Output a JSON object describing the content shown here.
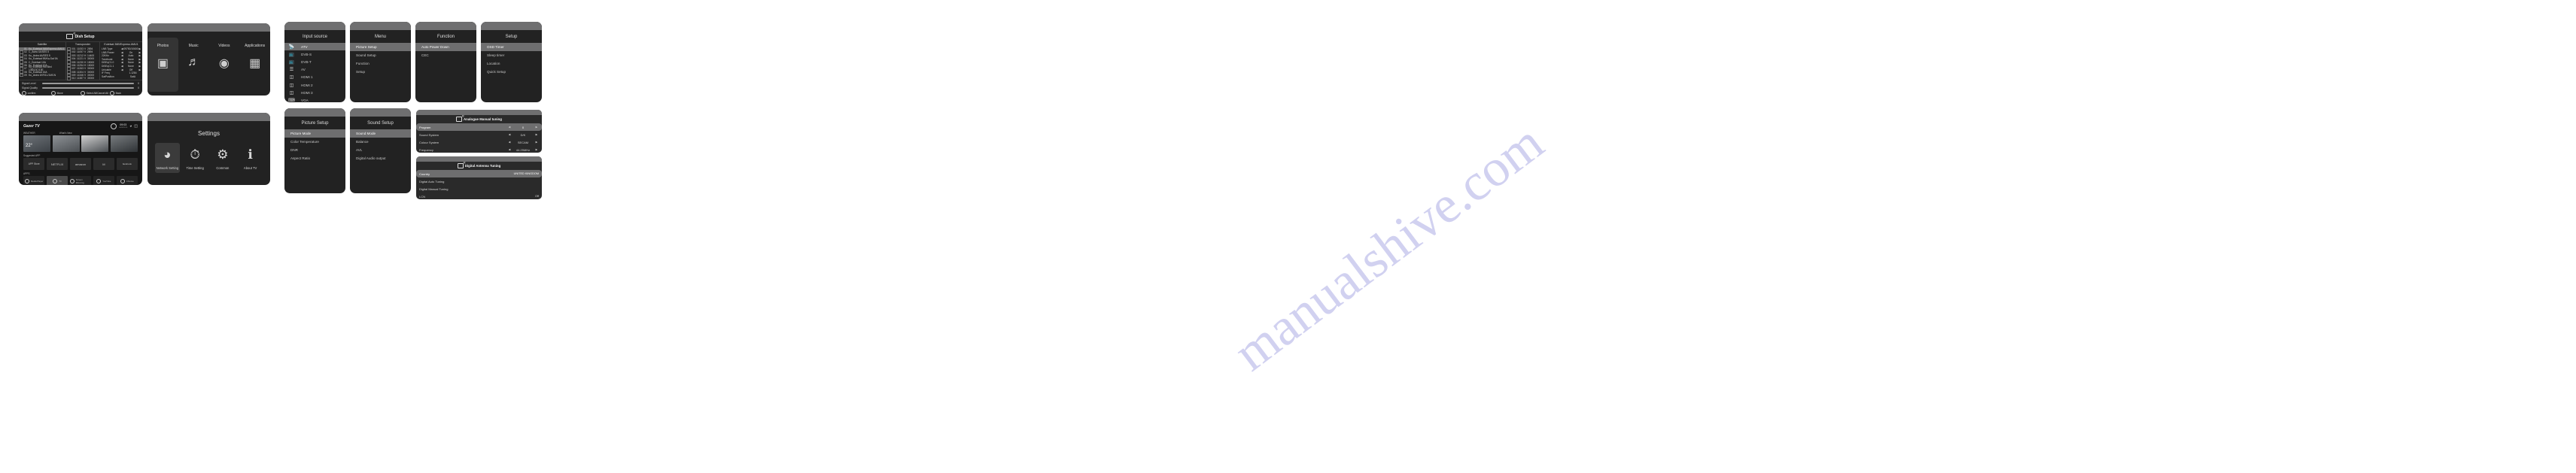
{
  "watermark": "manualshive.com",
  "dish_setup": {
    "title": "Dish Setup",
    "columns": {
      "satellite": "Satellite",
      "transponder": "Transponder",
      "lnb": "Eutelsat 36B/Express AMU1"
    },
    "satellites": [
      {
        "no": "01",
        "name": "Ku_Eutelsat 36B/Express AMU1"
      },
      {
        "no": "02",
        "name": "C_Astra 4A/SES 5"
      },
      {
        "no": "03",
        "name": "Ku_Astra 4A/SES 5"
      },
      {
        "no": "04",
        "name": "Ku_Eutelsat 9B/Ka-Sat 9A"
      },
      {
        "no": "05",
        "name": "C_Eutelsat 10A"
      },
      {
        "no": "06",
        "name": "Ku_Eutelsat 10A"
      },
      {
        "no": "07",
        "name": "Ku_Eutelsat Hot Bird 13B/13C/13E"
      },
      {
        "no": "08",
        "name": "Ku_Eutelsat 16A"
      },
      {
        "no": "09",
        "name": "Ku_Astra 1KR/1L/1M/1N"
      }
    ],
    "transponders": [
      {
        "no": "001",
        "freq": "11053",
        "pol": "V",
        "sr": "2894"
      },
      {
        "no": "002",
        "freq": "11057",
        "pol": "V",
        "sr": "2894"
      },
      {
        "no": "003",
        "freq": "11212",
        "pol": "H",
        "sr": "14400"
      },
      {
        "no": "004",
        "freq": "11221",
        "pol": "V",
        "sr": "30000"
      },
      {
        "no": "005",
        "freq": "11230",
        "pol": "H",
        "sr": "15000"
      },
      {
        "no": "006",
        "freq": "11254",
        "pol": "H",
        "sr": "15000"
      },
      {
        "no": "007",
        "freq": "11263",
        "pol": "V",
        "sr": "30000"
      },
      {
        "no": "008",
        "freq": "11304",
        "pol": "V",
        "sr": "30000"
      },
      {
        "no": "009",
        "freq": "11346",
        "pol": "V",
        "sr": "30000"
      },
      {
        "no": "010",
        "freq": "11387",
        "pol": "V",
        "sr": "30000"
      }
    ],
    "lnb_settings": [
      {
        "label": "LNB Type",
        "value": "09750/10600",
        "dimmed": false
      },
      {
        "label": "LNB Power",
        "value": "On",
        "dimmed": false
      },
      {
        "label": "22KHz",
        "value": "Auto",
        "dimmed": false
      },
      {
        "label": "Toneburst",
        "value": "None",
        "dimmed": false
      },
      {
        "label": "DiSEqC1.0",
        "value": "None",
        "dimmed": false
      },
      {
        "label": "DiSEqC1.1",
        "value": "None",
        "dimmed": false
      },
      {
        "label": "Unicable",
        "value": "Off",
        "dimmed": false
      },
      {
        "label": "IF Freq",
        "value": "1.1284",
        "dimmed": true
      },
      {
        "label": "SatPosition",
        "value": "SatA",
        "dimmed": true
      }
    ],
    "signal_level": {
      "label": "Signal Level",
      "value": "0"
    },
    "signal_quality": {
      "label": "Signal Quality",
      "value": "0"
    },
    "actions_row1": [
      "confirm",
      "Move",
      "Select All/Cancel All",
      "Back"
    ],
    "actions_row2": [
      "Delete",
      "Edit",
      "Add",
      "Scan"
    ]
  },
  "media": {
    "items": [
      {
        "label": "Photos",
        "icon": "photo-icon"
      },
      {
        "label": "Music",
        "icon": "music-icon"
      },
      {
        "label": "Videos",
        "icon": "film-reel-icon"
      },
      {
        "label": "Applications",
        "icon": "apps-icon"
      }
    ]
  },
  "input_source": {
    "title": "Input source",
    "items": [
      {
        "label": "ATV",
        "icon": "antenna-icon"
      },
      {
        "label": "DVB-S",
        "icon": "satellite-tv-icon"
      },
      {
        "label": "DVB-T",
        "icon": "terrestrial-tv-icon"
      },
      {
        "label": "AV",
        "icon": "av-icon"
      },
      {
        "label": "HDMI 1",
        "icon": "hdmi-icon"
      },
      {
        "label": "HDMI 2",
        "icon": "hdmi-icon"
      },
      {
        "label": "HDMI 3",
        "icon": "hdmi-icon"
      },
      {
        "label": "VGA",
        "icon": "vga-icon"
      }
    ]
  },
  "menu": {
    "title": "Menu",
    "items": [
      "Picture Setup",
      "Sound Setup",
      "Function",
      "Setup"
    ]
  },
  "function": {
    "title": "Function",
    "items": [
      "Auto Power Down",
      "CEC"
    ]
  },
  "setup": {
    "title": "Setup",
    "items": [
      "OSD Timer",
      "Sleep timer",
      "Location",
      "Quick Setup"
    ]
  },
  "gazer": {
    "logo": "Gazer TV",
    "clock": "09:03",
    "date": "06/09/2019",
    "sections": {
      "weather": "WEATHER",
      "whats_new": "What's New",
      "suggested": "Suggested APP",
      "apps": "APPS"
    },
    "weather_temp": "22°",
    "app_store": "APP Store",
    "apps_row": [
      "NETFLIX",
      "amazon",
      "M",
      "facebook"
    ],
    "apps_row2": [
      "Media Player",
      "TV",
      "Screen Mirroring",
      "YouTube",
      "Chrome"
    ]
  },
  "settings": {
    "title": "Settings",
    "items": [
      {
        "label": "Network Setting",
        "icon": "wifi-router-icon"
      },
      {
        "label": "Time Setting",
        "icon": "clock-icon"
      },
      {
        "label": "Common",
        "icon": "gear-icon"
      },
      {
        "label": "About TV",
        "icon": "info-icon"
      }
    ]
  },
  "picture_setup": {
    "title": "Picture Setup",
    "items": [
      "Picture Mode",
      "Color Temperature",
      "DNR",
      "Aspect Ratio"
    ]
  },
  "sound_setup": {
    "title": "Sound Setup",
    "items": [
      "Sound Mode",
      "Balance",
      "AVL",
      "Digital Audio output"
    ]
  },
  "analogue_tuning": {
    "title": "Analogue Manual tuning",
    "rows": [
      {
        "label": "Program",
        "value": "0"
      },
      {
        "label": "Sound System",
        "value": "D/K"
      },
      {
        "label": "Colour System",
        "value": "SECAM"
      },
      {
        "label": "Frequency",
        "value": "44.25MHz"
      }
    ]
  },
  "digital_tuning": {
    "title": "Digital Antenna Tuning",
    "rows": [
      {
        "label": "Country",
        "value": "UNITED KINGDOM"
      },
      {
        "label": "Digital Auto Tuning",
        "value": ""
      },
      {
        "label": "Digital Manual Tuning",
        "value": ""
      },
      {
        "label": "LCN",
        "value": "Off"
      }
    ]
  }
}
